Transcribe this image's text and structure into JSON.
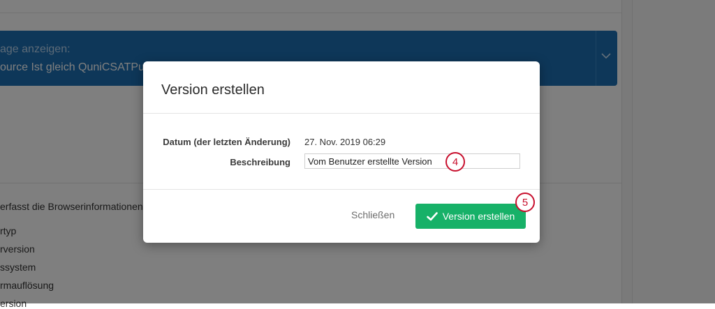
{
  "background": {
    "filter_prefix": "age anzeigen:",
    "filter_condition": "ource Ist gleich QuniCSATPuls",
    "browser_info_text": "erfasst die Browserinformationen d",
    "list_items": [
      "rtyp",
      "rversion",
      "ssystem",
      "rmauflösung",
      "ersion"
    ]
  },
  "modal": {
    "title": "Version erstellen",
    "date_label": "Datum (der letzten Änderung)",
    "date_value": "27. Nov. 2019 06:29",
    "description_label": "Beschreibung",
    "description_value": "Vom Benutzer erstellte Version",
    "close_label": "Schließen",
    "create_label": "Version erstellen",
    "check_icon": "checkmark-icon"
  },
  "annotations": {
    "step_description": "4",
    "step_create": "5"
  },
  "colors": {
    "primary_button": "#17b168",
    "banner": "#1c6fb3",
    "annotation_red": "#c8102e"
  }
}
